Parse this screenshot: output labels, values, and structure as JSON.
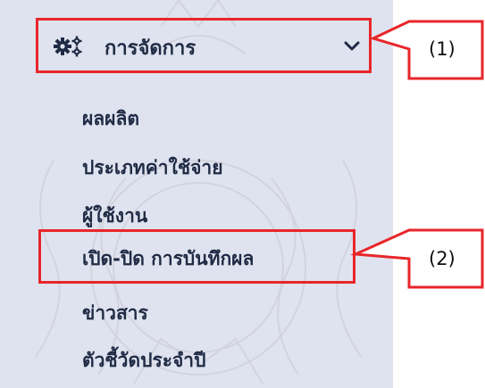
{
  "menu": {
    "header_label": "การจัดการ",
    "header_icon": "gears-icon",
    "toggle_icon": "chevron-down-icon",
    "items": [
      {
        "label": "ผลผลิต"
      },
      {
        "label": "ประเภทค่าใช้จ่าย"
      },
      {
        "label": "ผู้ใช้งาน"
      },
      {
        "label": "เปิด-ปิด การบันทึกผล"
      },
      {
        "label": "ข่าวสาร"
      },
      {
        "label": "ตัวชี้วัดประจำปี"
      }
    ]
  },
  "annotations": {
    "callout_1": "(1)",
    "callout_2": "(2)"
  },
  "colors": {
    "panel_bg": "#dfe3ef",
    "text": "#1f2a44",
    "highlight": "#e8262a"
  }
}
